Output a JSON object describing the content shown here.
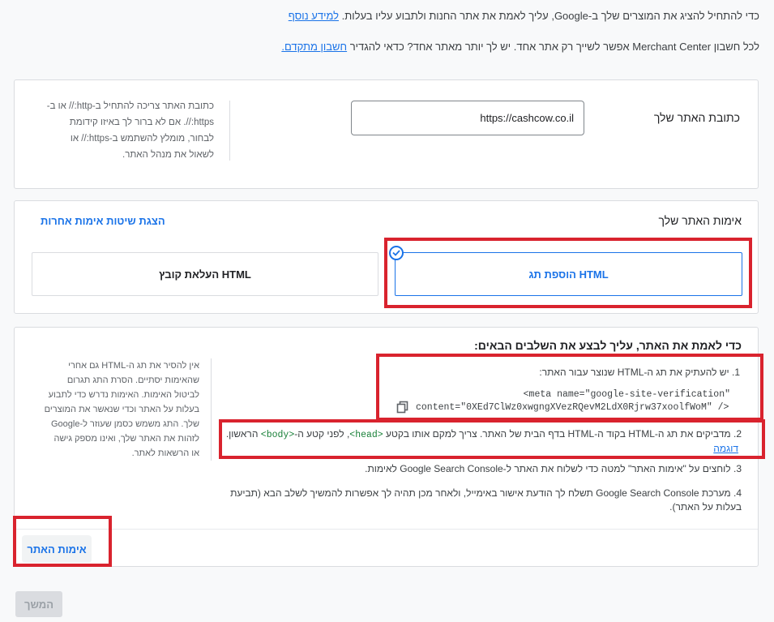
{
  "intro": {
    "line1_text": "כדי להתחיל להציג את המוצרים שלך ב-Google, עליך לאמת את אתר החנות ולתבוע עליו בעלות.",
    "line1_link": "למידע נוסף",
    "line2_text": "לכל חשבון Merchant Center אפשר לשייך רק אתר אחד. יש לך יותר מאתר אחד? כדאי להגדיר",
    "line2_link": "חשבון מתקדם."
  },
  "website": {
    "label": "כתובת האתר שלך",
    "url_value": "https://cashcow.co.il",
    "helper": "כתובת האתר צריכה להתחיל ב-http:// או ב-https://. אם לא ברור לך באיזו קידומת לבחור, מומלץ להשתמש ב-https:// או לשאול את מנהל האתר."
  },
  "verification": {
    "title": "אימות האתר שלך",
    "other_methods_link": "הצגת שיטות אימות אחרות",
    "option_html_tag": "הוספת תג HTML",
    "option_html_file": "העלאת קובץ HTML"
  },
  "steps": {
    "heading": "כדי לאמת את האתר, עליך לבצע את השלבים הבאים:",
    "step1": "1. יש להעתיק את תג ה-HTML שנוצר עבור האתר:",
    "meta_line1": "<meta name=\"google-site-verification\"",
    "meta_line2": "content=\"0XEd7ClWz0xwgngXVezRQevM2LdX0Rjrw37xoolfWoM\" />",
    "step2_a": "2. מדביקים את תג ה-HTML בקוד ה-HTML בדף הבית של האתר. צריך למקם אותו בקטע",
    "step2_head": "<head>",
    "step2_b": ", לפני קטע ה-",
    "step2_body": "<body>",
    "step2_c": " הראשון.",
    "step2_example": "דוגמה",
    "step3": "3. לוחצים על \"אימות האתר\" למטה כדי לשלוח את האתר ל-Google Search Console לאימות.",
    "step4": "4. מערכת Google Search Console תשלח לך הודעת אישור באימייל, ולאחר מכן תהיה לך אפשרות להמשיך לשלב הבא (תביעת בעלות על האתר).",
    "helper": "אין להסיר את תג ה-HTML גם אחרי שהאימות יסתיים. הסרת התג תגרום לביטול האימות. האימות נדרש כדי לתבוע בעלות על האתר וכדי שנאשר את המוצרים שלך. התג משמש כסמן שעוזר ל-Google לזהות את האתר שלך, ואינו מספק גישה או הרשאות לאתר.",
    "verify_button": "אימות האתר"
  },
  "footer": {
    "next_button": "המשך"
  },
  "colors": {
    "accent": "#1a73e8",
    "highlight": "#d9232e"
  }
}
